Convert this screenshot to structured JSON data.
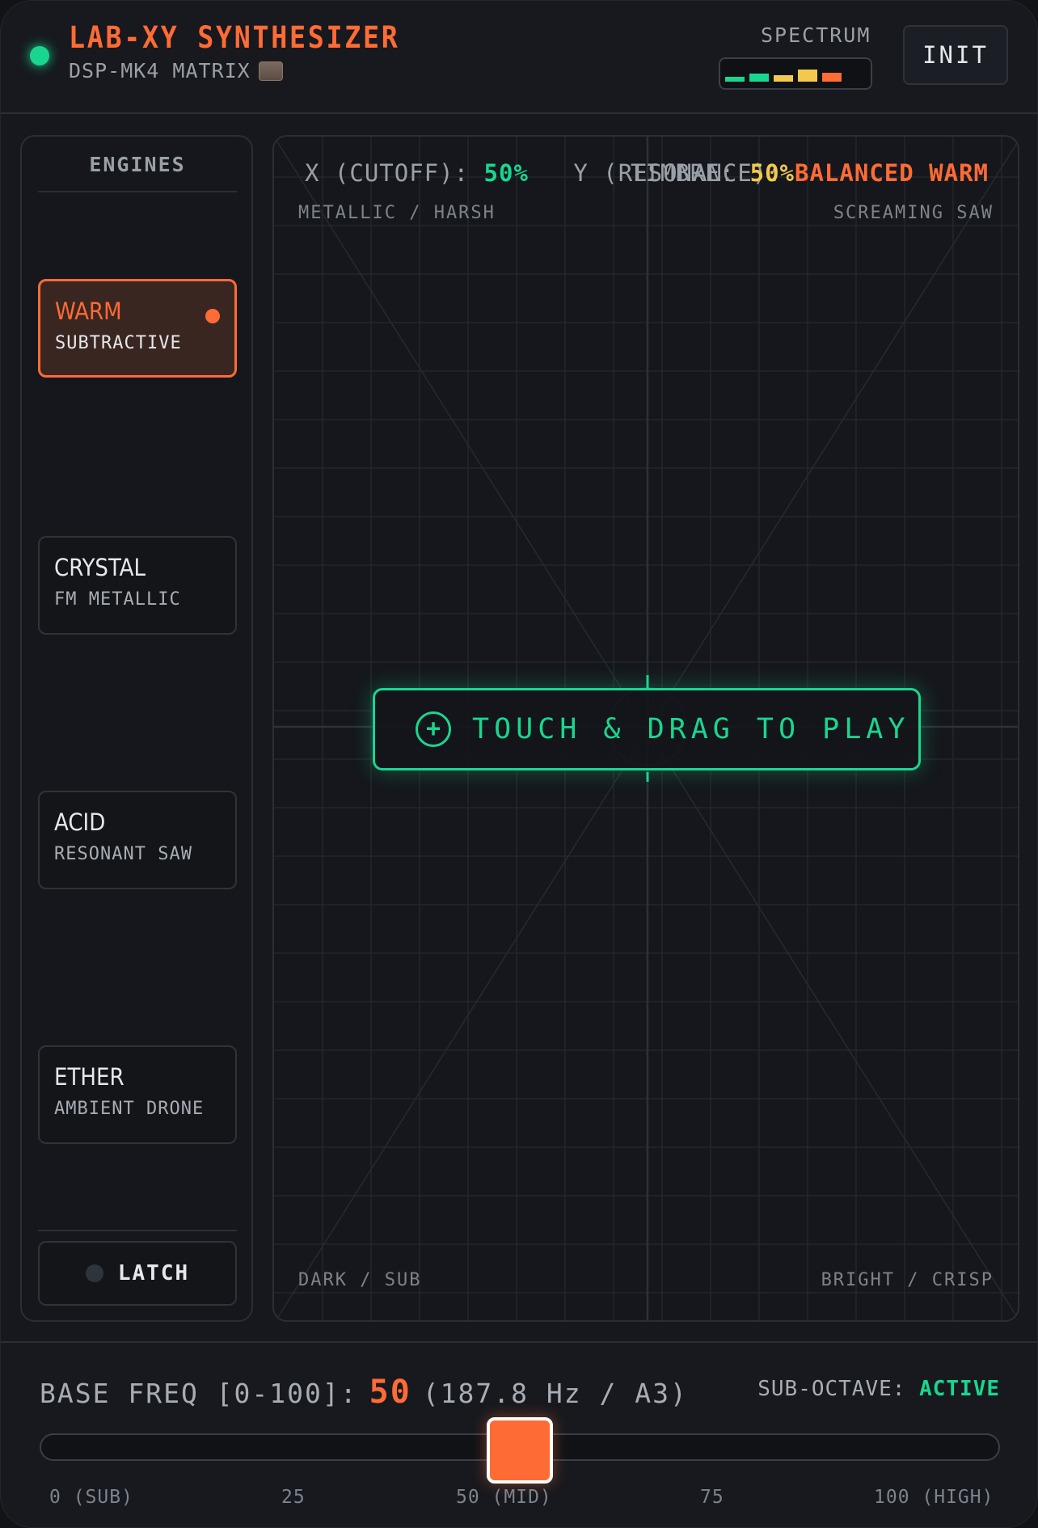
{
  "header": {
    "title": "LAB-XY SYNTHESIZER",
    "subtitle": "DSP-MK4 MATRIX",
    "spectrum_label": "SPECTRUM",
    "init_label": "INIT",
    "spectrum_colors": [
      "#19d68f",
      "#19d68f",
      "#f2c94c",
      "#f2c94c",
      "#ff6b35"
    ],
    "spectrum_levels": [
      0.25,
      0.45,
      0.35,
      0.7,
      0.5
    ]
  },
  "sidebar": {
    "title": "ENGINES",
    "engines": [
      {
        "name": "WARM",
        "subtitle": "SUBTRACTIVE",
        "active": true
      },
      {
        "name": "CRYSTAL",
        "subtitle": "FM METALLIC",
        "active": false
      },
      {
        "name": "ACID",
        "subtitle": "RESONANT SAW",
        "active": false
      },
      {
        "name": "ETHER",
        "subtitle": "AMBIENT DRONE",
        "active": false
      }
    ],
    "latch_label": "LATCH"
  },
  "pad": {
    "x_label": "X (CUTOFF):",
    "x_value": "50%",
    "y_label": "Y (RESONANCE):",
    "y_value": "50%",
    "timbre_label": "TIMBRE:",
    "timbre_value": "BALANCED WARM",
    "corner_top_left": "METALLIC / HARSH",
    "corner_top_right": "SCREAMING SAW",
    "corner_bottom_left": "DARK / SUB",
    "corner_bottom_right": "BRIGHT / CRISP",
    "touch_label": "TOUCH & DRAG TO PLAY"
  },
  "bottom": {
    "freq_label": "BASE FREQ [0-100]:",
    "freq_value": "50",
    "freq_detail": "(187.8 Hz / A3)",
    "sub_octave_label": "SUB-OCTAVE:",
    "sub_octave_value": "ACTIVE",
    "slider_fraction": 0.5,
    "ticks": [
      "0 (SUB)",
      "25",
      "50 (MID)",
      "75",
      "100 (HIGH)"
    ]
  },
  "colors": {
    "accent": "#ff6b35",
    "green": "#19d68f",
    "yellow": "#f2c94c"
  }
}
